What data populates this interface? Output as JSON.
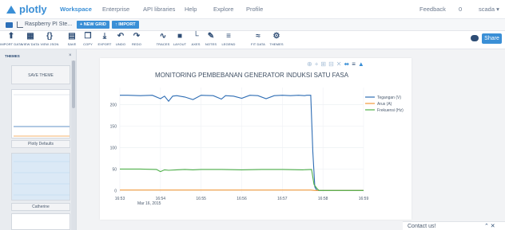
{
  "nav": {
    "logo": "plotly",
    "items": [
      "Workspace",
      "Enterprise",
      "API libraries",
      "Help",
      "Explore",
      "Profile"
    ],
    "feedback": "Feedback",
    "count": "0",
    "user": "scada ▾"
  },
  "file": {
    "name": "Raspberry PI Ste...",
    "new_grid": "+ NEW GRID",
    "import": "↑ IMPORT"
  },
  "toolbar": {
    "tools": [
      {
        "icon": "upload-icon",
        "glyph": "⬆",
        "label": "IMPORT DATA"
      },
      {
        "icon": "grid-icon",
        "glyph": "▦",
        "label": "VIEW DATA"
      },
      {
        "icon": "braces-icon",
        "glyph": "{}",
        "label": "VIEW JSON"
      },
      {
        "icon": "save-icon",
        "glyph": "▤",
        "label": "SAVE"
      },
      {
        "icon": "copy-icon",
        "glyph": "❐",
        "label": "COPY"
      },
      {
        "icon": "export-icon",
        "glyph": "⤓",
        "label": "EXPORT"
      },
      {
        "icon": "undo-icon",
        "glyph": "↶",
        "label": "UNDO"
      },
      {
        "icon": "redo-icon",
        "glyph": "↷",
        "label": "REDO"
      },
      {
        "icon": "traces-icon",
        "glyph": "∿",
        "label": "TRACES"
      },
      {
        "icon": "layout-icon",
        "glyph": "■",
        "label": "LAYOUT"
      },
      {
        "icon": "axes-icon",
        "glyph": "└",
        "label": "AXES"
      },
      {
        "icon": "notes-icon",
        "glyph": "✎",
        "label": "NOTES"
      },
      {
        "icon": "legend-icon",
        "glyph": "≡",
        "label": "LEGEND"
      },
      {
        "icon": "fit-data-icon",
        "glyph": "≈",
        "label": "FIT DATA"
      },
      {
        "icon": "themes-icon",
        "glyph": "⚙",
        "label": "THEMES"
      }
    ],
    "share": "Share"
  },
  "panel": {
    "title": "THEMES",
    "save_theme": "SAVE THEME",
    "themes": [
      "Plotly Defaults",
      "Catherine"
    ]
  },
  "contact": {
    "label": "Contact us!",
    "controls": "⌃ ✕"
  },
  "colors": {
    "accent": "#3a8fd6",
    "tegangan": "#2e6db4",
    "arus": "#f29a3b",
    "frekuensi": "#4fb04a"
  },
  "chart_data": {
    "type": "line",
    "title": "MONITORING PEMBEBANAN GENERATOR INDUKSI SATU FASA",
    "xlabel": "",
    "ylabel": "",
    "x_ticks": [
      "16:53",
      "16:54",
      "16:55",
      "16:56",
      "16:57",
      "16:58",
      "16:59"
    ],
    "x_date_label": "Mar 16, 2015",
    "y_ticks": [
      0,
      50,
      100,
      150,
      200
    ],
    "ylim": [
      -5,
      240
    ],
    "xlim": [
      0.0,
      6.0
    ],
    "grid": true,
    "legend": "top-right",
    "series": [
      {
        "name": "Tegangan (V)",
        "color": "#2e6db4",
        "x": [
          0.0,
          0.2,
          0.5,
          0.8,
          1.0,
          1.1,
          1.2,
          1.3,
          1.4,
          1.6,
          1.8,
          2.0,
          2.3,
          2.5,
          2.6,
          2.8,
          3.0,
          3.2,
          3.4,
          3.6,
          3.8,
          4.0,
          4.2,
          4.4,
          4.55,
          4.6,
          4.7,
          4.75,
          4.8,
          4.85,
          4.9,
          5.0,
          5.5,
          6.0
        ],
        "y": [
          222,
          222,
          221,
          222,
          214,
          220,
          208,
          220,
          221,
          218,
          212,
          222,
          221,
          213,
          221,
          220,
          215,
          222,
          221,
          214,
          221,
          222,
          221,
          222,
          221,
          222,
          222,
          90,
          8,
          0,
          0,
          0,
          0,
          0
        ]
      },
      {
        "name": "Arus (A)",
        "color": "#f29a3b",
        "x": [
          0.0,
          1.0,
          2.0,
          3.0,
          4.0,
          4.7,
          4.8,
          5.0,
          6.0
        ],
        "y": [
          1,
          1,
          1,
          1,
          1,
          1,
          0,
          0,
          0
        ]
      },
      {
        "name": "Frekuensi (Hz)",
        "color": "#4fb04a",
        "x": [
          0.0,
          0.5,
          0.9,
          1.0,
          1.1,
          1.2,
          1.4,
          1.6,
          1.8,
          2.0,
          2.5,
          3.0,
          3.5,
          4.0,
          4.5,
          4.72,
          4.78,
          4.85,
          4.9,
          5.0,
          6.0
        ],
        "y": [
          50,
          50,
          49,
          44,
          48,
          47,
          48,
          49,
          48,
          49,
          49,
          48,
          49,
          49,
          48,
          49,
          14,
          5,
          0,
          0,
          0
        ]
      }
    ]
  }
}
